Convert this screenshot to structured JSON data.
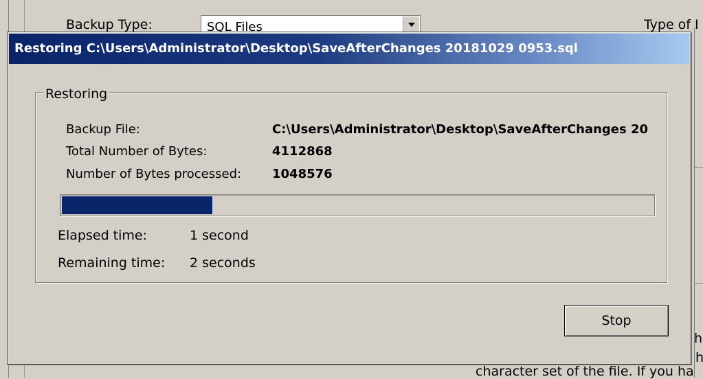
{
  "background": {
    "backup_type_label": "Backup Type:",
    "backup_type_value": "SQL Files",
    "type_label": "Type of I",
    "bottom_text_1": "h",
    "bottom_text_2": "h",
    "bottom_text_3": "character set of the file. If you ha"
  },
  "dialog": {
    "title": "Restoring C:\\Users\\Administrator\\Desktop\\SaveAfterChanges 20181029 0953.sql",
    "group_title": "Restoring",
    "fields": {
      "backup_file_label": "Backup File:",
      "backup_file_value": "C:\\Users\\Administrator\\Desktop\\SaveAfterChanges 20",
      "total_bytes_label": "Total Number of Bytes:",
      "total_bytes_value": "4112868",
      "processed_bytes_label": "Number of Bytes processed:",
      "processed_bytes_value": "1048576"
    },
    "progress_fraction": 0.255,
    "elapsed_label": "Elapsed time:",
    "elapsed_value": "1 second",
    "remaining_label": "Remaining time:",
    "remaining_value": "2 seconds",
    "stop_label": "Stop"
  },
  "colors": {
    "progress_fill": "#0a246a",
    "titlebar_start": "#0a246a",
    "titlebar_end": "#a6caf0",
    "face": "#d4d0c8"
  }
}
